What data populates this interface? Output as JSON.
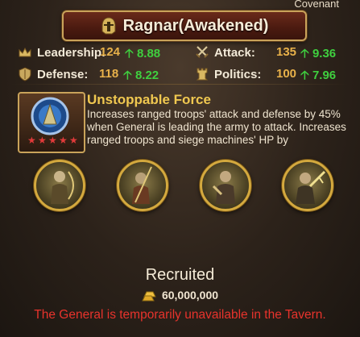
{
  "corner_label": "Covenant",
  "general": {
    "name": "Ragnar(Awakened)"
  },
  "stats": {
    "leadership": {
      "label": "Leadership:",
      "value": "124",
      "bonus": "8.88"
    },
    "attack": {
      "label": "Attack:",
      "value": "135",
      "bonus": "9.36"
    },
    "defense": {
      "label": "Defense:",
      "value": "118",
      "bonus": "8.22"
    },
    "politics": {
      "label": "Politics:",
      "value": "100",
      "bonus": "7.96"
    }
  },
  "skill": {
    "title": "Unstoppable Force",
    "stars": 5,
    "description": "Increases ranged troops' attack and defense by 45% when General is leading the army to attack. Increases ranged troops and siege machines' HP by"
  },
  "portraits": [
    "archer-portrait",
    "spearman-portrait",
    "warrior-portrait",
    "swordsman-portrait"
  ],
  "status": "Recruited",
  "price": "60,000,000",
  "warning": "The General is temporarily unavailable in the Tavern.",
  "colors": {
    "gold": "#e8b14a",
    "bonus_green": "#3fcf3f",
    "warning_red": "#e8332c",
    "title_yellow": "#f0c850"
  },
  "icons": {
    "leadership": "crown-icon",
    "attack": "crossed-swords-icon",
    "defense": "shield-icon",
    "politics": "rook-tower-icon",
    "price": "gold-ingot-icon",
    "banner": "helmet-icon"
  }
}
